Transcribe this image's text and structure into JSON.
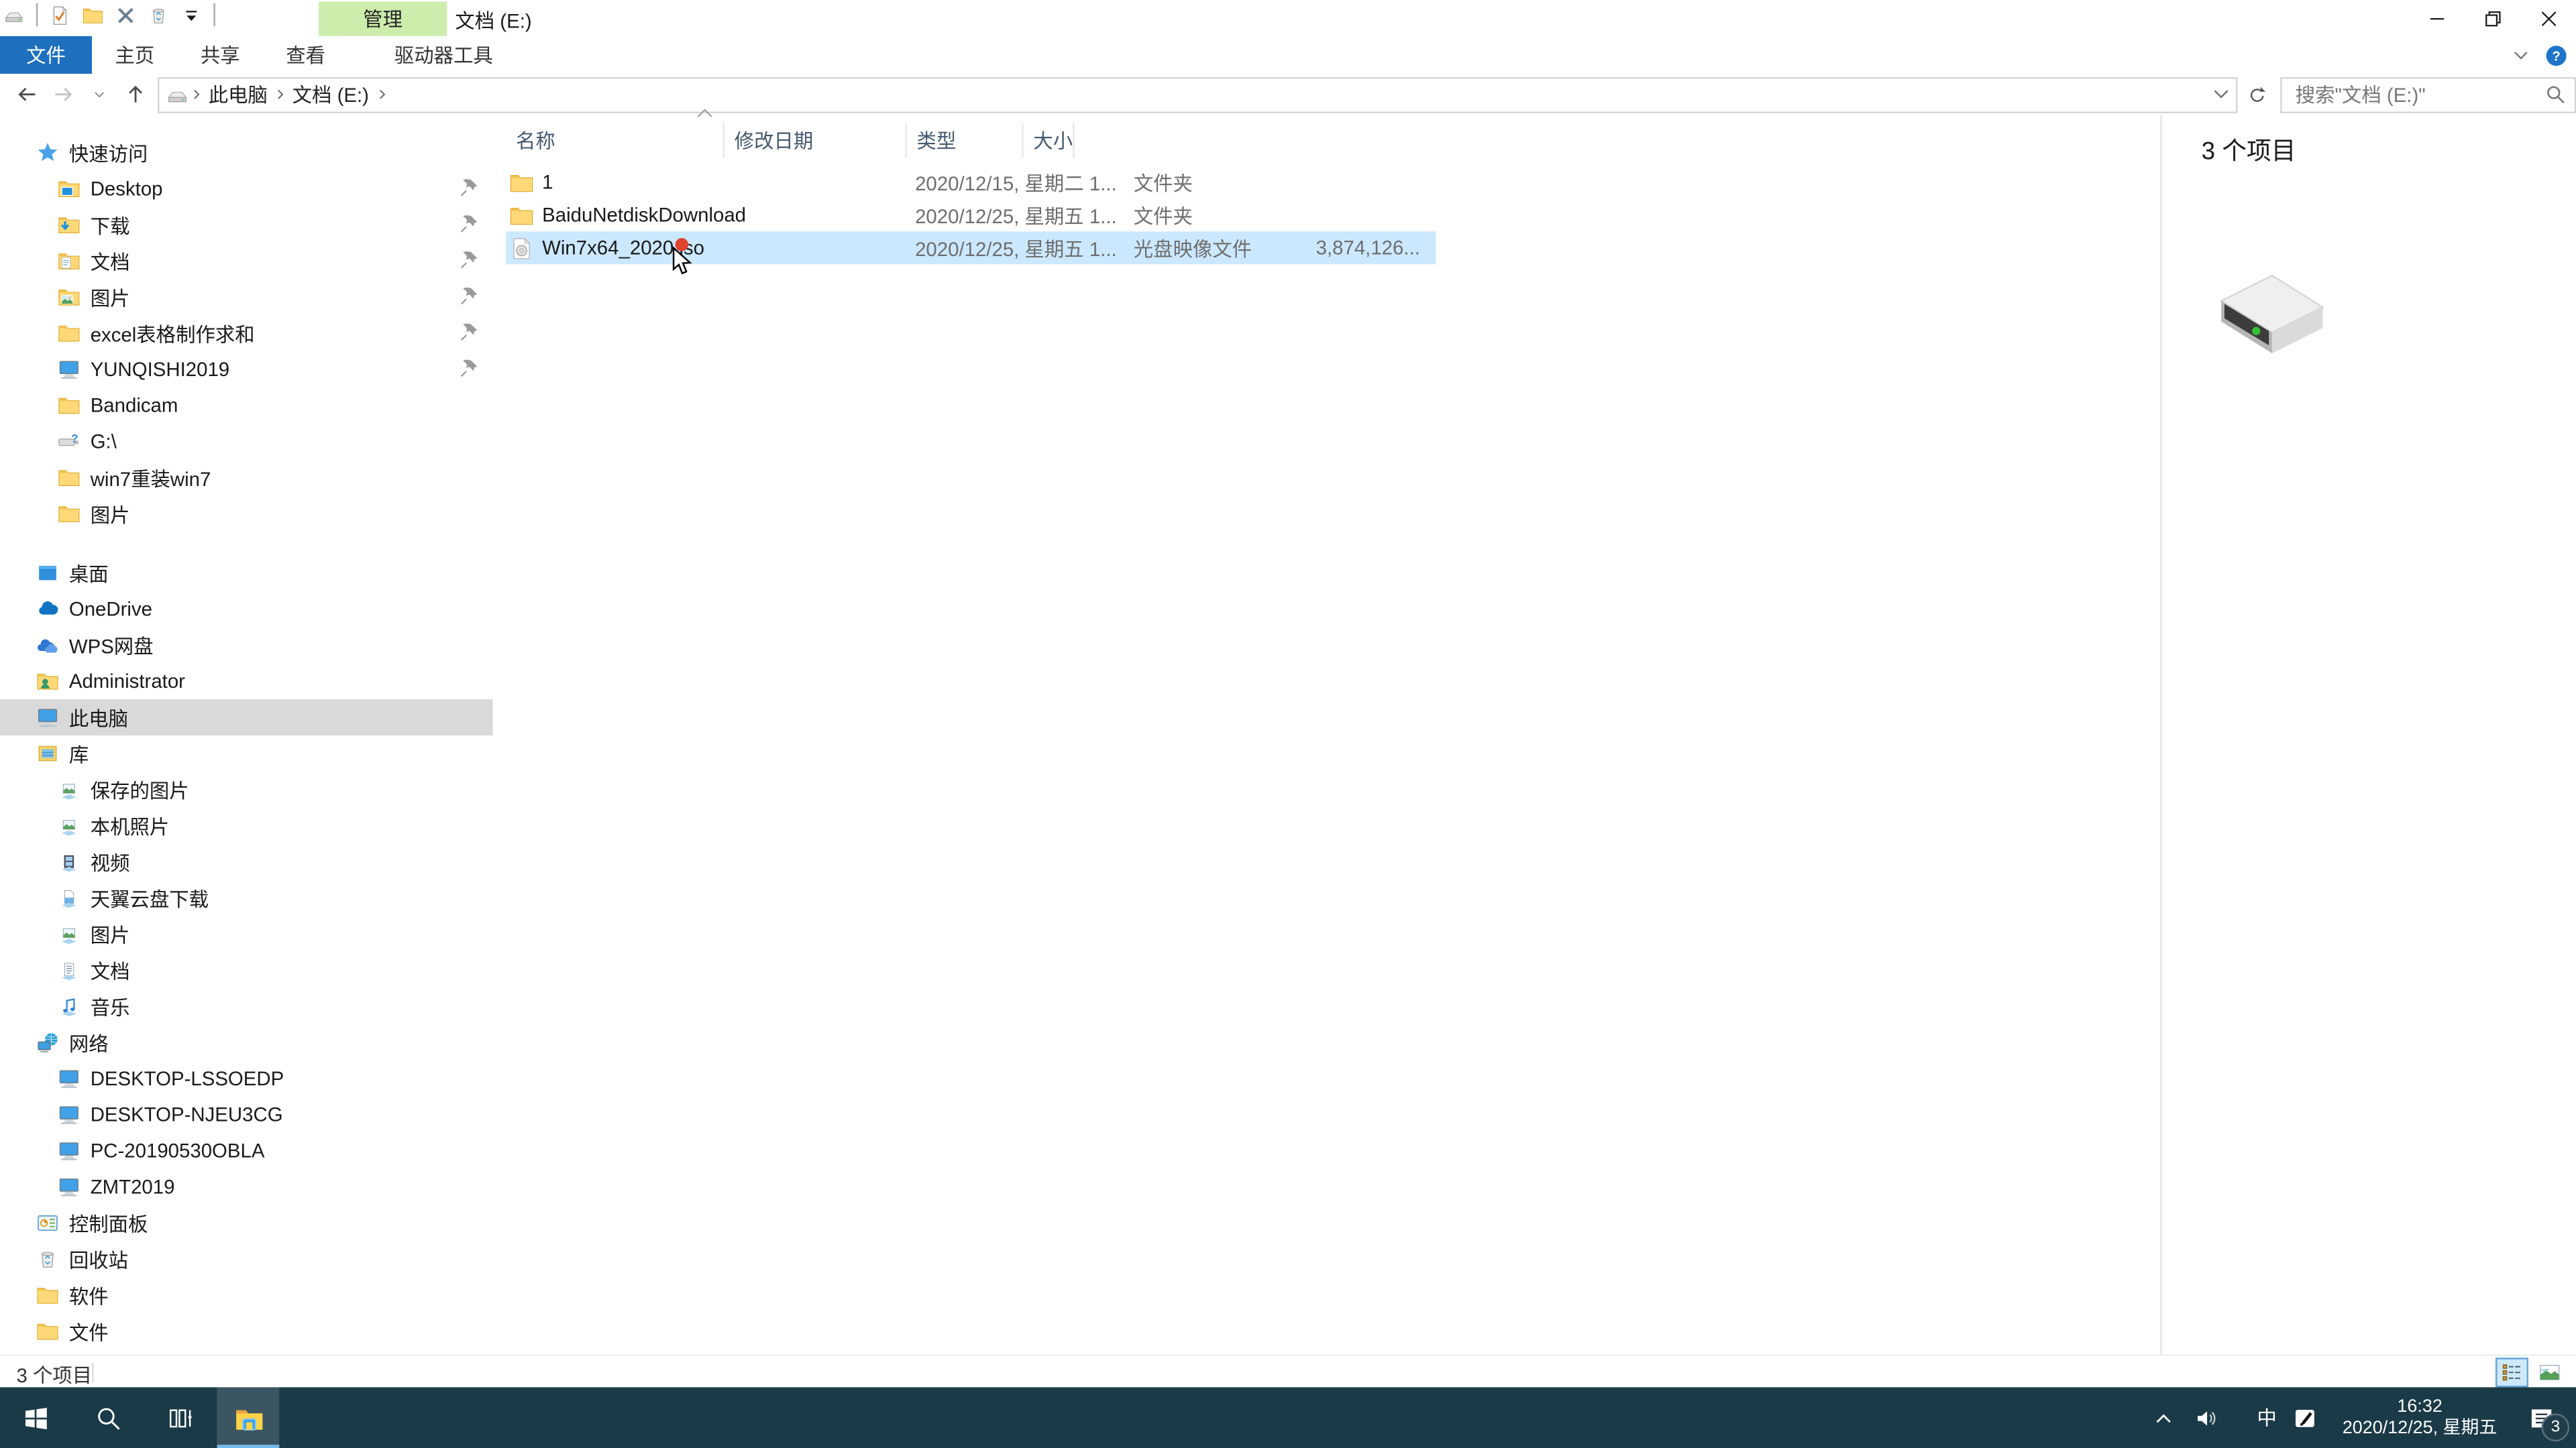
{
  "window": {
    "title": "文档 (E:)",
    "contextual_tab_group": "管理",
    "qat_icons": [
      {
        "icon": "check-document-icon"
      },
      {
        "icon": "new-folder-icon"
      },
      {
        "icon": "delete-icon"
      },
      {
        "icon": "recycle-bin-icon"
      },
      {
        "icon": "qat-dropdown-icon"
      }
    ]
  },
  "ribbon": {
    "tabs": [
      {
        "label": "文件",
        "file": true
      },
      {
        "label": "主页"
      },
      {
        "label": "共享"
      },
      {
        "label": "查看"
      },
      {
        "label": "驱动器工具",
        "contextual": true
      }
    ]
  },
  "address_bar": {
    "breadcrumb": [
      {
        "label": "此电脑"
      },
      {
        "label": "文档 (E:)"
      }
    ],
    "search_placeholder": "搜索\"文档 (E:)\""
  },
  "sidebar": {
    "items": [
      {
        "label": "快速访问",
        "icon": "star-icon",
        "level": 0
      },
      {
        "label": "Desktop",
        "icon": "folder-desktop-icon",
        "level": 1,
        "pinned": true
      },
      {
        "label": "下载",
        "icon": "folder-download-icon",
        "level": 1,
        "pinned": true
      },
      {
        "label": "文档",
        "icon": "folder-documents-icon",
        "level": 1,
        "pinned": true
      },
      {
        "label": "图片",
        "icon": "folder-pictures-icon",
        "level": 1,
        "pinned": true
      },
      {
        "label": "excel表格制作求和",
        "icon": "folder-icon",
        "level": 1,
        "pinned": true
      },
      {
        "label": "YUNQISHI2019",
        "icon": "computer-icon",
        "level": 1,
        "pinned": true
      },
      {
        "label": "Bandicam",
        "icon": "folder-icon",
        "level": 1
      },
      {
        "label": "G:\\",
        "icon": "usb-drive-icon",
        "level": 1
      },
      {
        "label": "win7重装win7",
        "icon": "folder-icon",
        "level": 1
      },
      {
        "label": "图片",
        "icon": "folder-icon",
        "level": 1
      },
      {
        "label": "桌面",
        "icon": "desktop-icon",
        "level": 0,
        "gap": true
      },
      {
        "label": "OneDrive",
        "icon": "onedrive-icon",
        "level": 0
      },
      {
        "label": "WPS网盘",
        "icon": "wps-cloud-icon",
        "level": 0
      },
      {
        "label": "Administrator",
        "icon": "folder-user-icon",
        "level": 0
      },
      {
        "label": "此电脑",
        "icon": "computer-icon",
        "level": 0,
        "selected": true
      },
      {
        "label": "库",
        "icon": "libraries-icon",
        "level": 0
      },
      {
        "label": "保存的图片",
        "icon": "library-pictures-icon",
        "level": 1
      },
      {
        "label": "本机照片",
        "icon": "library-pictures-icon",
        "level": 1
      },
      {
        "label": "视频",
        "icon": "library-videos-icon",
        "level": 1
      },
      {
        "label": "天翼云盘下载",
        "icon": "library-download-icon",
        "level": 1
      },
      {
        "label": "图片",
        "icon": "library-pictures-icon",
        "level": 1
      },
      {
        "label": "文档",
        "icon": "library-documents-icon",
        "level": 1
      },
      {
        "label": "音乐",
        "icon": "library-music-icon",
        "level": 1
      },
      {
        "label": "网络",
        "icon": "network-icon",
        "level": 0
      },
      {
        "label": "DESKTOP-LSSOEDP",
        "icon": "network-pc-icon",
        "level": 1
      },
      {
        "label": "DESKTOP-NJEU3CG",
        "icon": "network-pc-icon",
        "level": 1
      },
      {
        "label": "PC-20190530OBLA",
        "icon": "network-pc-icon",
        "level": 1
      },
      {
        "label": "ZMT2019",
        "icon": "network-pc-icon",
        "level": 1
      },
      {
        "label": "控制面板",
        "icon": "control-panel-icon",
        "level": 0
      },
      {
        "label": "回收站",
        "icon": "recycle-bin-icon",
        "level": 0
      },
      {
        "label": "软件",
        "icon": "folder-icon",
        "level": 0
      },
      {
        "label": "文件",
        "icon": "folder-icon",
        "level": 0
      }
    ]
  },
  "file_list": {
    "columns": [
      {
        "label": "名称"
      },
      {
        "label": "修改日期"
      },
      {
        "label": "类型"
      },
      {
        "label": "大小"
      }
    ],
    "rows": [
      {
        "name": "1",
        "icon": "folder-icon",
        "date": "2020/12/15, 星期二 1...",
        "type": "文件夹",
        "size": ""
      },
      {
        "name": "BaiduNetdiskDownload",
        "icon": "folder-icon",
        "date": "2020/12/25, 星期五 1...",
        "type": "文件夹",
        "size": ""
      },
      {
        "name": "Win7x64_2020.iso",
        "icon": "iso-icon",
        "date": "2020/12/25, 星期五 1...",
        "type": "光盘映像文件",
        "size": "3,874,126...",
        "selected": true
      }
    ]
  },
  "preview_pane": {
    "item_count": "3 个项目",
    "icon": "hard-drive-icon"
  },
  "status_bar": {
    "item_count": "3 个项目"
  },
  "taskbar": {
    "tray_items": [
      {
        "name": "hidden-icons-chevron",
        "icon": "chevron-up-icon"
      },
      {
        "name": "volume",
        "icon": "speaker-icon"
      },
      {
        "name": "ime-indicator",
        "label": "中"
      },
      {
        "name": "tray-app",
        "icon": "tray-pen-icon"
      }
    ],
    "time": "16:32",
    "date": "2020/12/25, 星期五",
    "notification_badge": "3"
  }
}
